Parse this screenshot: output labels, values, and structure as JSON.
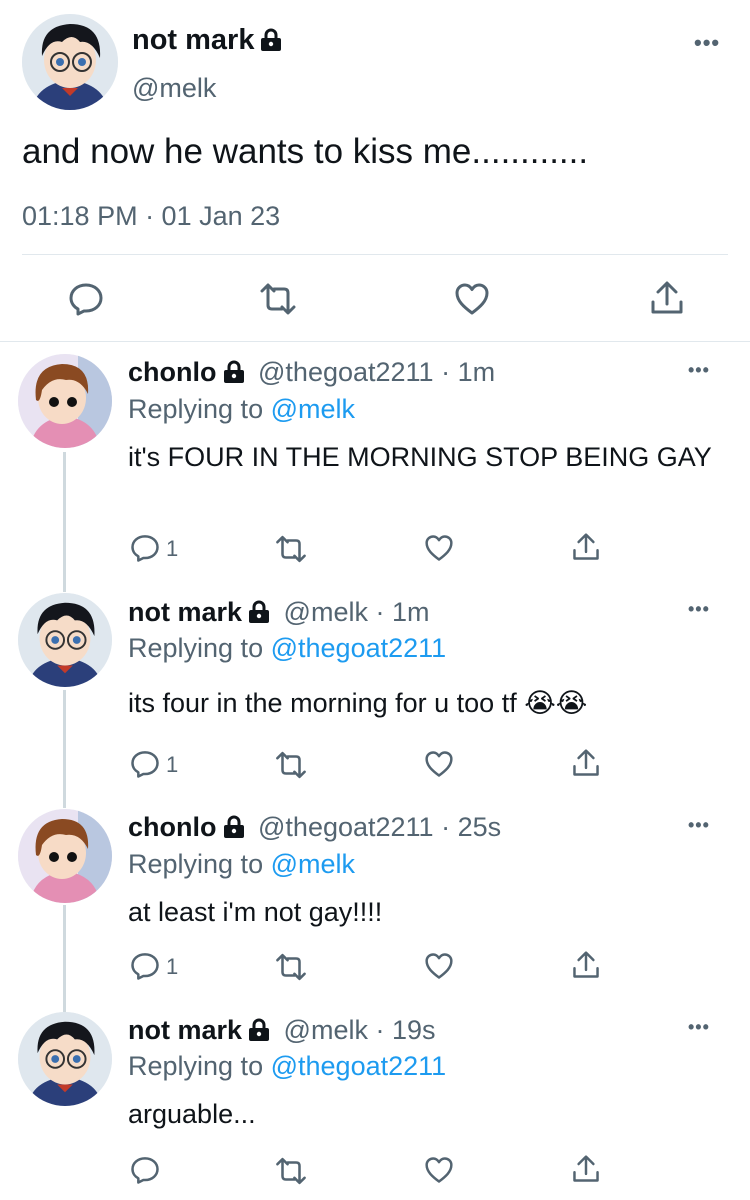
{
  "main_tweet": {
    "name": "not mark",
    "handle": "@melk",
    "text": "and now he wants to kiss me............",
    "timestamp": "01:18 PM · 01 Jan 23"
  },
  "replies": [
    {
      "name": "chonlo",
      "handle": "@thegoat2211",
      "time": "· 1m",
      "replying_label": "Replying to",
      "replying_to": "@melk",
      "text": "it's FOUR IN THE MORNING STOP BEING GAY",
      "reply_count": "1"
    },
    {
      "name": "not mark",
      "handle": "@melk",
      "time": "· 1m",
      "replying_label": "Replying to",
      "replying_to": "@thegoat2211",
      "text": "its four in the morning for u too tf 😭😭",
      "reply_count": "1"
    },
    {
      "name": "chonlo",
      "handle": "@thegoat2211",
      "time": "· 25s",
      "replying_label": "Replying to",
      "replying_to": "@melk",
      "text": "at least i'm not gay!!!!",
      "reply_count": "1"
    },
    {
      "name": "not mark",
      "handle": "@melk",
      "time": "· 19s",
      "replying_label": "Replying to",
      "replying_to": "@thegoat2211",
      "text": "arguable...",
      "reply_count": ""
    }
  ],
  "more_glyph": "•••",
  "icons": {
    "reply": "reply-bubble-icon",
    "retweet": "retweet-icon",
    "like": "heart-icon",
    "share": "share-icon",
    "lock": "lock-icon"
  },
  "colors": {
    "link": "#1d9bf0",
    "secondary_text": "#536471",
    "thread_line": "#cfd9de"
  }
}
